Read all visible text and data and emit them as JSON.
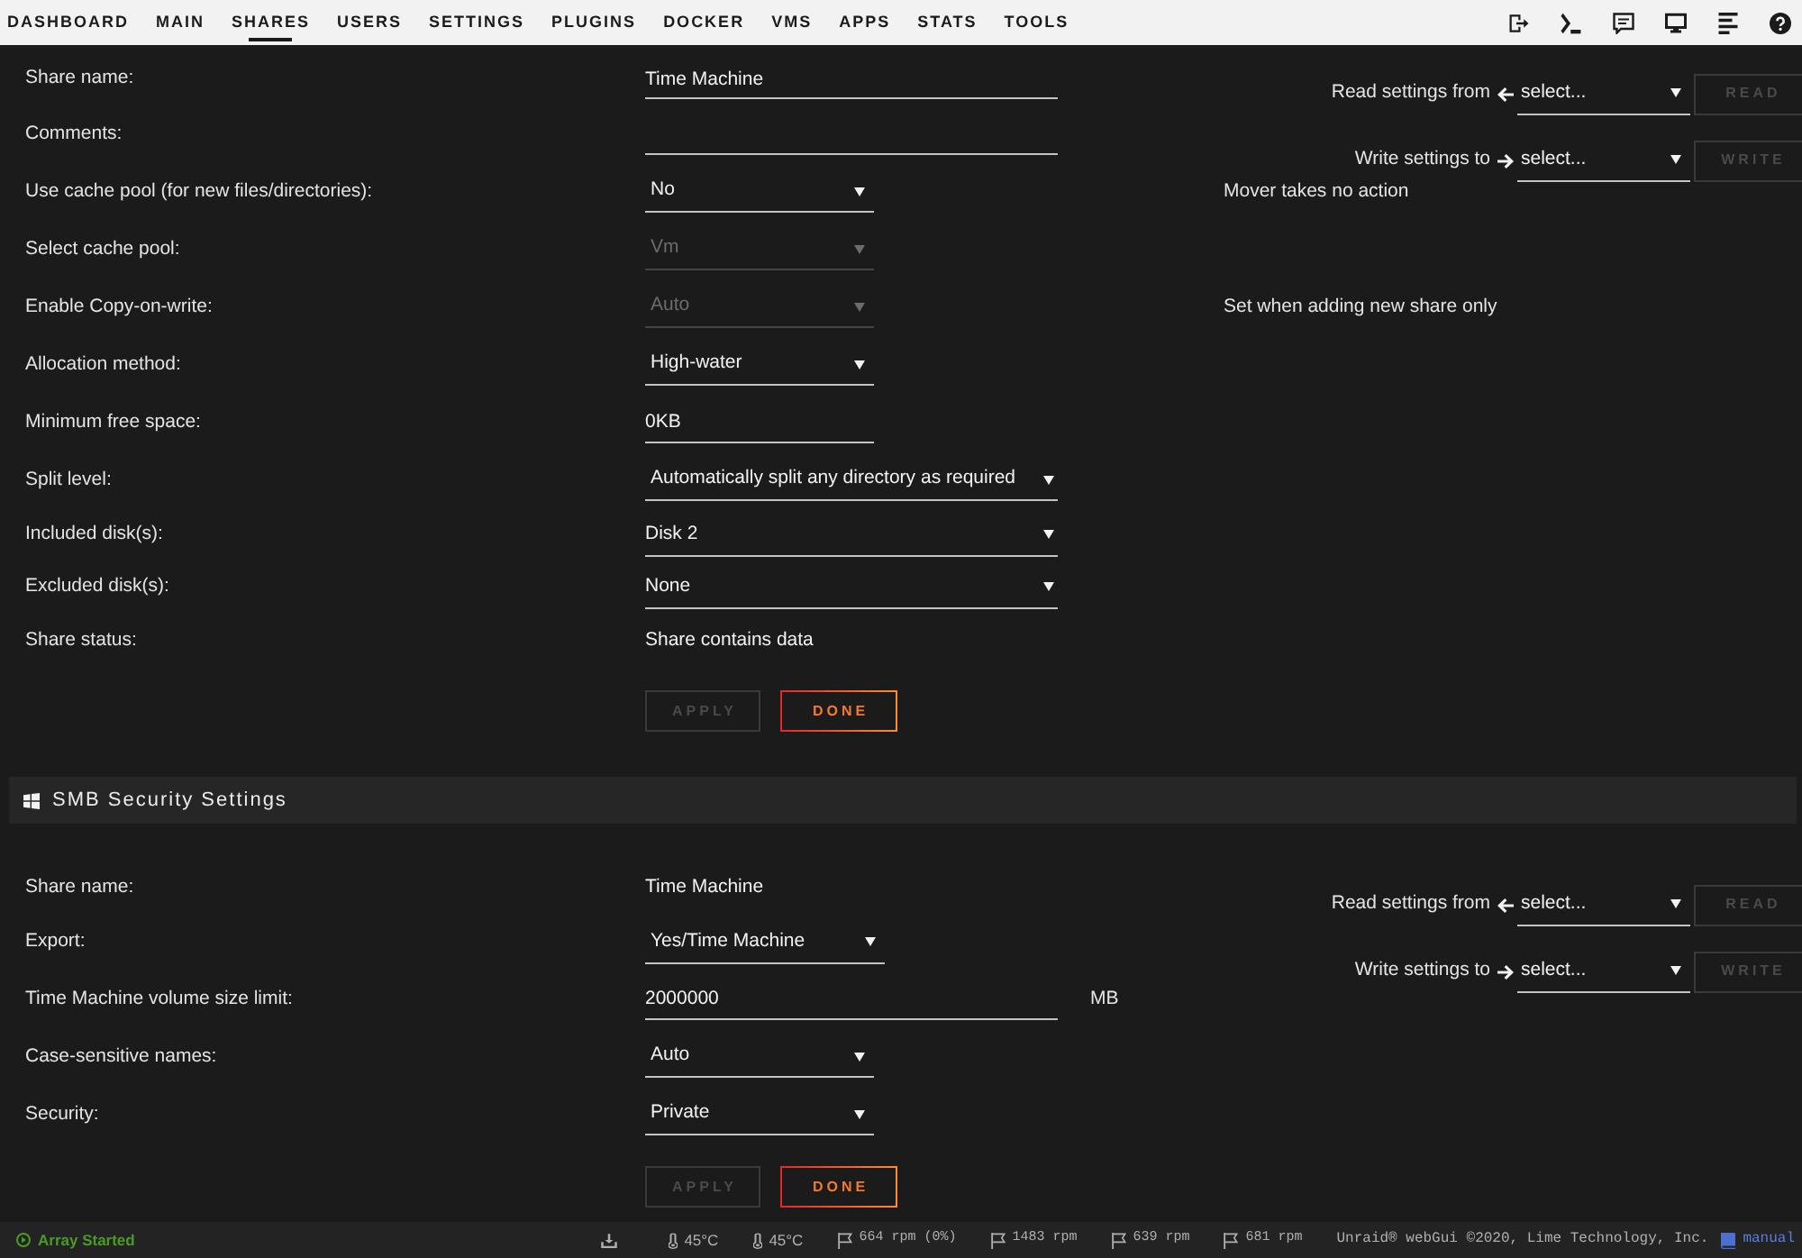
{
  "nav": {
    "tabs": [
      {
        "label": "DASHBOARD",
        "selected": false
      },
      {
        "label": "MAIN",
        "selected": false
      },
      {
        "label": "SHARES",
        "selected": true
      },
      {
        "label": "USERS",
        "selected": false
      },
      {
        "label": "SETTINGS",
        "selected": false
      },
      {
        "label": "PLUGINS",
        "selected": false
      },
      {
        "label": "DOCKER",
        "selected": false
      },
      {
        "label": "VMS",
        "selected": false
      },
      {
        "label": "APPS",
        "selected": false
      },
      {
        "label": "STATS",
        "selected": false
      },
      {
        "label": "TOOLS",
        "selected": false
      }
    ]
  },
  "share_settings": {
    "rows": [
      {
        "label": "Share name:",
        "kind": "input",
        "value": "Time Machine",
        "disabled": false
      },
      {
        "label": "Comments:",
        "kind": "input",
        "disabled": false
      },
      {
        "label": "Use cache pool (for new files/directories):",
        "kind": "select",
        "value": "No",
        "disabled": false,
        "note": "Mover takes no action"
      },
      {
        "label": "Select cache pool:",
        "kind": "select",
        "value": "Vm",
        "disabled": true
      },
      {
        "label": "Enable Copy-on-write:",
        "kind": "select",
        "value": "Auto",
        "disabled": true,
        "note": "Set when adding new share only"
      },
      {
        "label": "Allocation method:",
        "kind": "select",
        "value": "High-water",
        "disabled": false
      },
      {
        "label": "Minimum free space:",
        "kind": "input",
        "value": "0KB",
        "disabled": false
      },
      {
        "label": "Split level:",
        "kind": "select",
        "value": "Automatically split any directory as required",
        "disabled": false
      },
      {
        "label": "Included disk(s):",
        "kind": "multiselect",
        "value": "Disk 2",
        "disabled": false
      },
      {
        "label": "Excluded disk(s):",
        "kind": "multiselect",
        "value": "None",
        "disabled": false
      },
      {
        "label": "Share status:",
        "kind": "text",
        "value": "Share contains data",
        "disabled": false
      }
    ],
    "transfer": [
      {
        "kind": "read",
        "label": "Read settings from",
        "value": "select...",
        "button": "READ",
        "disabled": true
      },
      {
        "kind": "write",
        "label": "Write settings to",
        "value": "select...",
        "button": "WRITE",
        "disabled": true
      }
    ],
    "buttons": [
      {
        "label": "APPLY",
        "disabled": true
      },
      {
        "label": "DONE",
        "disabled": false
      }
    ]
  },
  "smb_security_settings": {
    "title": "SMB Security Settings",
    "rows": [
      {
        "label": "Share name:",
        "kind": "text",
        "value": "Time Machine",
        "disabled": false
      },
      {
        "label": "Export:",
        "kind": "select",
        "value": "Yes/Time Machine",
        "disabled": false
      },
      {
        "label": "Time Machine volume size limit:",
        "kind": "input",
        "value": "2000000",
        "unit": "MB",
        "disabled": false
      },
      {
        "label": "Case-sensitive names:",
        "kind": "select",
        "value": "Auto",
        "disabled": false
      },
      {
        "label": "Security:",
        "kind": "select",
        "value": "Private",
        "disabled": false
      }
    ],
    "transfer": [
      {
        "kind": "read",
        "label": "Read settings from",
        "value": "select...",
        "button": "READ",
        "disabled": true
      },
      {
        "kind": "write",
        "label": "Write settings to",
        "value": "select...",
        "button": "WRITE",
        "disabled": true
      }
    ],
    "buttons": [
      {
        "label": "APPLY",
        "disabled": true
      },
      {
        "label": "DONE",
        "disabled": false
      }
    ]
  },
  "status_bar": {
    "array_status": "Array Started",
    "readings": [
      {
        "kind": "temperature",
        "text": "45°C"
      },
      {
        "kind": "temperature",
        "text": "45°C"
      },
      {
        "kind": "speed",
        "text": "664 rpm (0%)"
      },
      {
        "kind": "speed",
        "text": "1483 rpm"
      },
      {
        "kind": "speed",
        "text": "639 rpm"
      },
      {
        "kind": "speed",
        "text": "681 rpm"
      }
    ],
    "copyright": "Unraid® webGui ©2020, Lime Technology, Inc.",
    "manual_link": "manual"
  }
}
